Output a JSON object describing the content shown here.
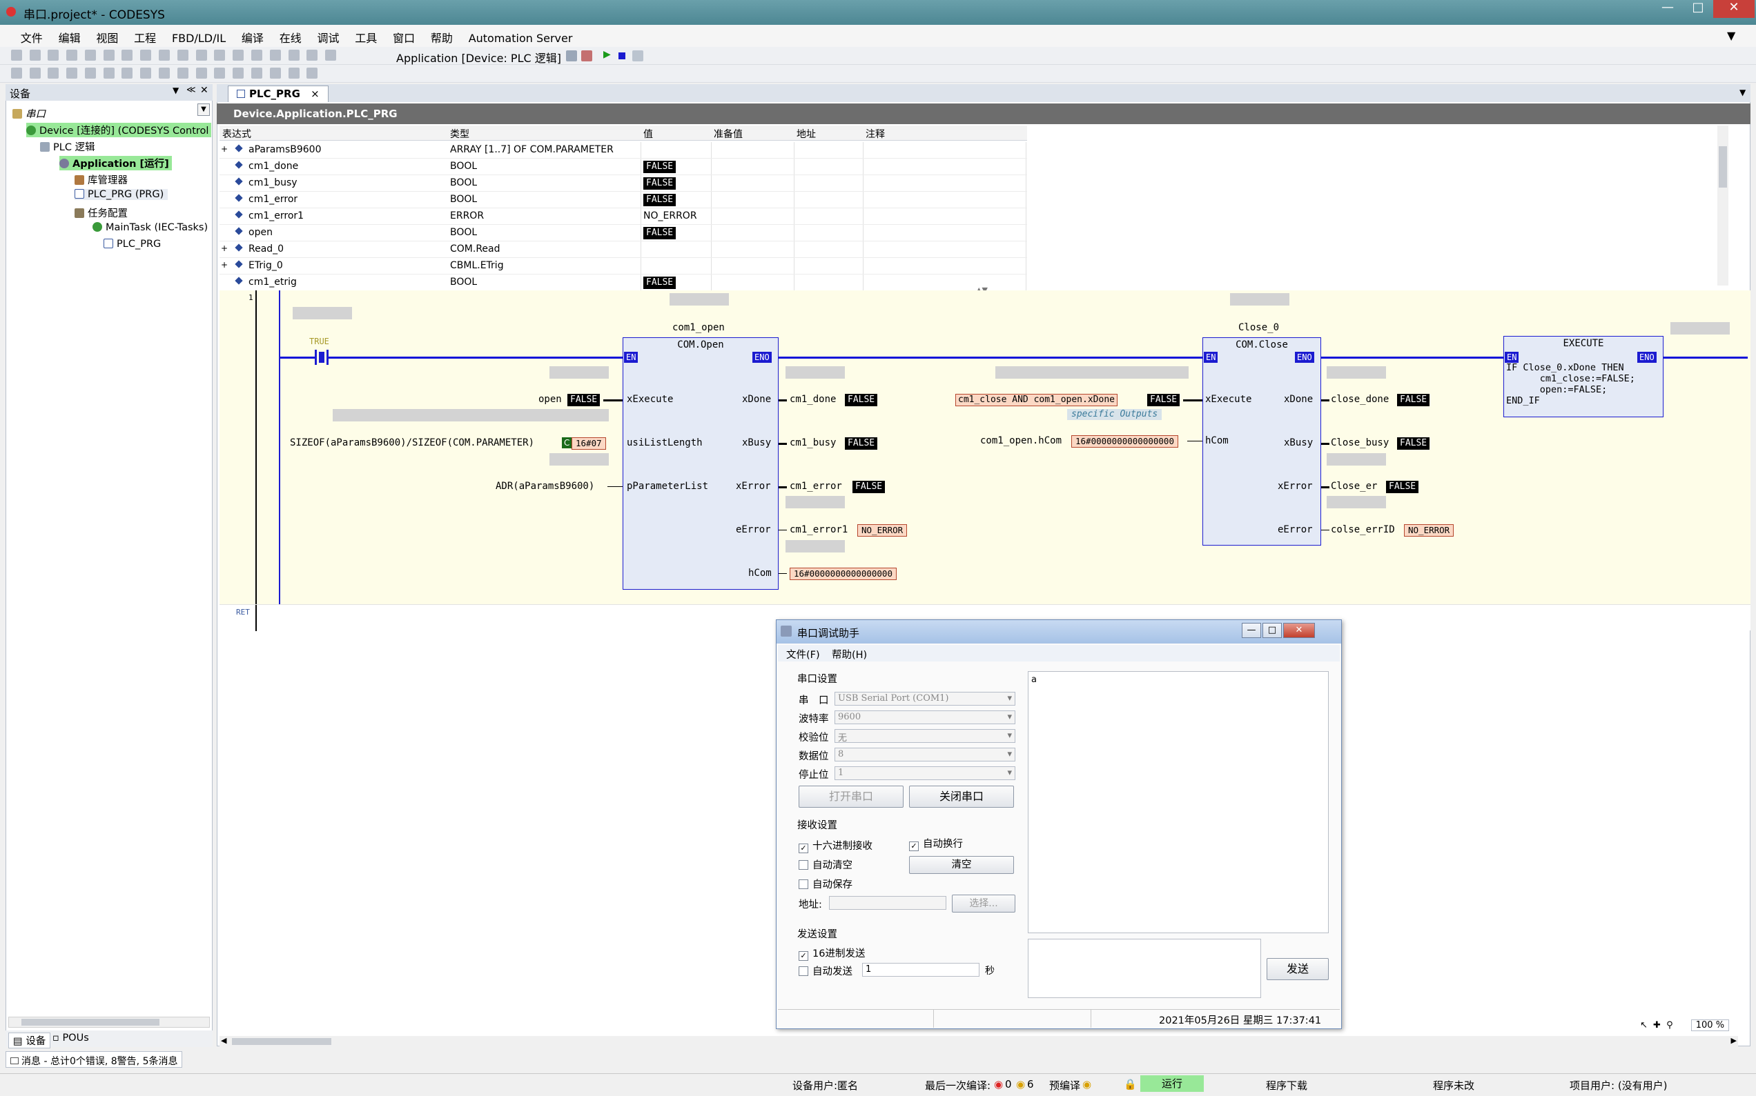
{
  "window": {
    "title": "串口.project* - CODESYS"
  },
  "menu": [
    "文件",
    "编辑",
    "视图",
    "工程",
    "FBD/LD/IL",
    "编译",
    "在线",
    "调试",
    "工具",
    "窗口",
    "帮助",
    "Automation Server"
  ],
  "toolbar": {
    "app_label": "Application [Device: PLC 逻辑]"
  },
  "devices_panel": {
    "title": "设备"
  },
  "tree": {
    "root": "串口",
    "device": "Device [连接的] (CODESYS Control",
    "plc": "PLC 逻辑",
    "app": "Application [运行]",
    "lib": "库管理器",
    "prg": "PLC_PRG (PRG)",
    "taskcfg": "任务配置",
    "maintask": "MainTask (IEC-Tasks)",
    "task_prg": "PLC_PRG"
  },
  "bottom_tabs": {
    "devices": "设备",
    "pous": "POUs"
  },
  "editor": {
    "tab": "PLC_PRG",
    "path": "Device.Application.PLC_PRG"
  },
  "var_table": {
    "headers": [
      "表达式",
      "类型",
      "值",
      "准备值",
      "地址",
      "注释"
    ],
    "rows": [
      {
        "expr": "aParamsB9600",
        "type": "ARRAY [1..7] OF COM.PARAMETER",
        "value": "",
        "expand": "+"
      },
      {
        "expr": "cm1_done",
        "type": "BOOL",
        "value": "FALSE",
        "expand": ""
      },
      {
        "expr": "cm1_busy",
        "type": "BOOL",
        "value": "FALSE",
        "expand": ""
      },
      {
        "expr": "cm1_error",
        "type": "BOOL",
        "value": "FALSE",
        "expand": ""
      },
      {
        "expr": "cm1_error1",
        "type": "ERROR",
        "value": "NO_ERROR",
        "expand": ""
      },
      {
        "expr": "open",
        "type": "BOOL",
        "value": "FALSE",
        "expand": ""
      },
      {
        "expr": "Read_0",
        "type": "COM.Read",
        "value": "",
        "expand": "+"
      },
      {
        "expr": "ETrig_0",
        "type": "CBML.ETrig",
        "value": "",
        "expand": "+"
      },
      {
        "expr": "cm1_etrig",
        "type": "BOOL",
        "value": "FALSE",
        "expand": ""
      }
    ]
  },
  "fbd": {
    "network_no": "1",
    "ret": "RET",
    "true_contact": "TRUE",
    "open_block": {
      "instance": "com1_open",
      "type": "COM.Open",
      "en": "EN",
      "eno": "ENO",
      "inputs": [
        "xExecute",
        "usiListLength",
        "pParameterList"
      ],
      "outputs": [
        "xDone",
        "xBusy",
        "xError",
        "eError",
        "hCom"
      ],
      "in_open": "open",
      "in_open_val": "FALSE",
      "in_len_expr": "SIZEOF(aParamsB9600)/SIZEOF(COM.PARAMETER)",
      "in_len_c": "C",
      "in_len_val": "16#07",
      "in_param": "ADR(aParamsB9600)",
      "out_done": "cm1_done",
      "out_done_val": "FALSE",
      "out_busy": "cm1_busy",
      "out_busy_val": "FALSE",
      "out_error": "cm1_error",
      "out_error_val": "FALSE",
      "out_eerror": "cm1_error1",
      "out_eerror_val": "NO_ERROR",
      "out_hcom_val": "16#0000000000000000"
    },
    "close_block": {
      "instance": "Close_0",
      "type": "COM.Close",
      "en": "EN",
      "eno": "ENO",
      "inputs": [
        "xExecute",
        "hCom"
      ],
      "outputs": [
        "xDone",
        "xBusy",
        "xError",
        "eError"
      ],
      "in_exec": "cm1_close AND com1_open.xDone",
      "in_exec_val": "FALSE",
      "in_comment": "specific Outputs",
      "in_hcom": "com1_open.hCom",
      "in_hcom_val": "16#0000000000000000",
      "out_done": "close_done",
      "out_done_val": "FALSE",
      "out_busy": "Close_busy",
      "out_busy_val": "FALSE",
      "out_error": "Close_er",
      "out_error_val": "FALSE",
      "out_eerror": "colse_errID",
      "out_eerror_val": "NO_ERROR"
    },
    "exec_block": {
      "type": "EXECUTE",
      "en": "EN",
      "eno": "ENO",
      "code": [
        "IF Close_0.xDone THEN",
        "      cm1_close:=FALSE;",
        "      open:=FALSE;",
        "END_IF"
      ]
    }
  },
  "dialog": {
    "title": "串口调试助手",
    "menu": [
      "文件(F)",
      "帮助(H)"
    ],
    "serial_group": "串口设置",
    "fields": [
      {
        "label": "串　口",
        "value": "USB Serial Port (COM1)"
      },
      {
        "label": "波特率",
        "value": "9600"
      },
      {
        "label": "校验位",
        "value": "无"
      },
      {
        "label": "数据位",
        "value": "8"
      },
      {
        "label": "停止位",
        "value": "1"
      }
    ],
    "open_btn": "打开串口",
    "close_btn": "关闭串口",
    "recv_group": "接收设置",
    "hex_recv": "十六进制接收",
    "auto_wrap": "自动换行",
    "auto_clear": "自动清空",
    "clear_btn": "清空",
    "auto_save": "自动保存",
    "addr_label": "地址:",
    "choose_btn": "选择...",
    "send_group": "发送设置",
    "hex_send": "16进制发送",
    "auto_send": "自动发送",
    "auto_send_val": "1",
    "sec": "秒",
    "recv_text": "a",
    "send_btn": "发送",
    "datetime": "2021年05月26日 星期三 17:37:41"
  },
  "messages": {
    "summary": "消息 - 总计0个错误, 8警告, 5条消息"
  },
  "zoom": "100 %",
  "status": {
    "user": "设备用户:匿名",
    "last_compile": "最后一次编译:",
    "errors": "0",
    "warnings": "6",
    "precompile": "预编译",
    "run": "运行",
    "download": "程序下载",
    "unchanged": "程序未改",
    "project_user": "项目用户: (没有用户)"
  }
}
